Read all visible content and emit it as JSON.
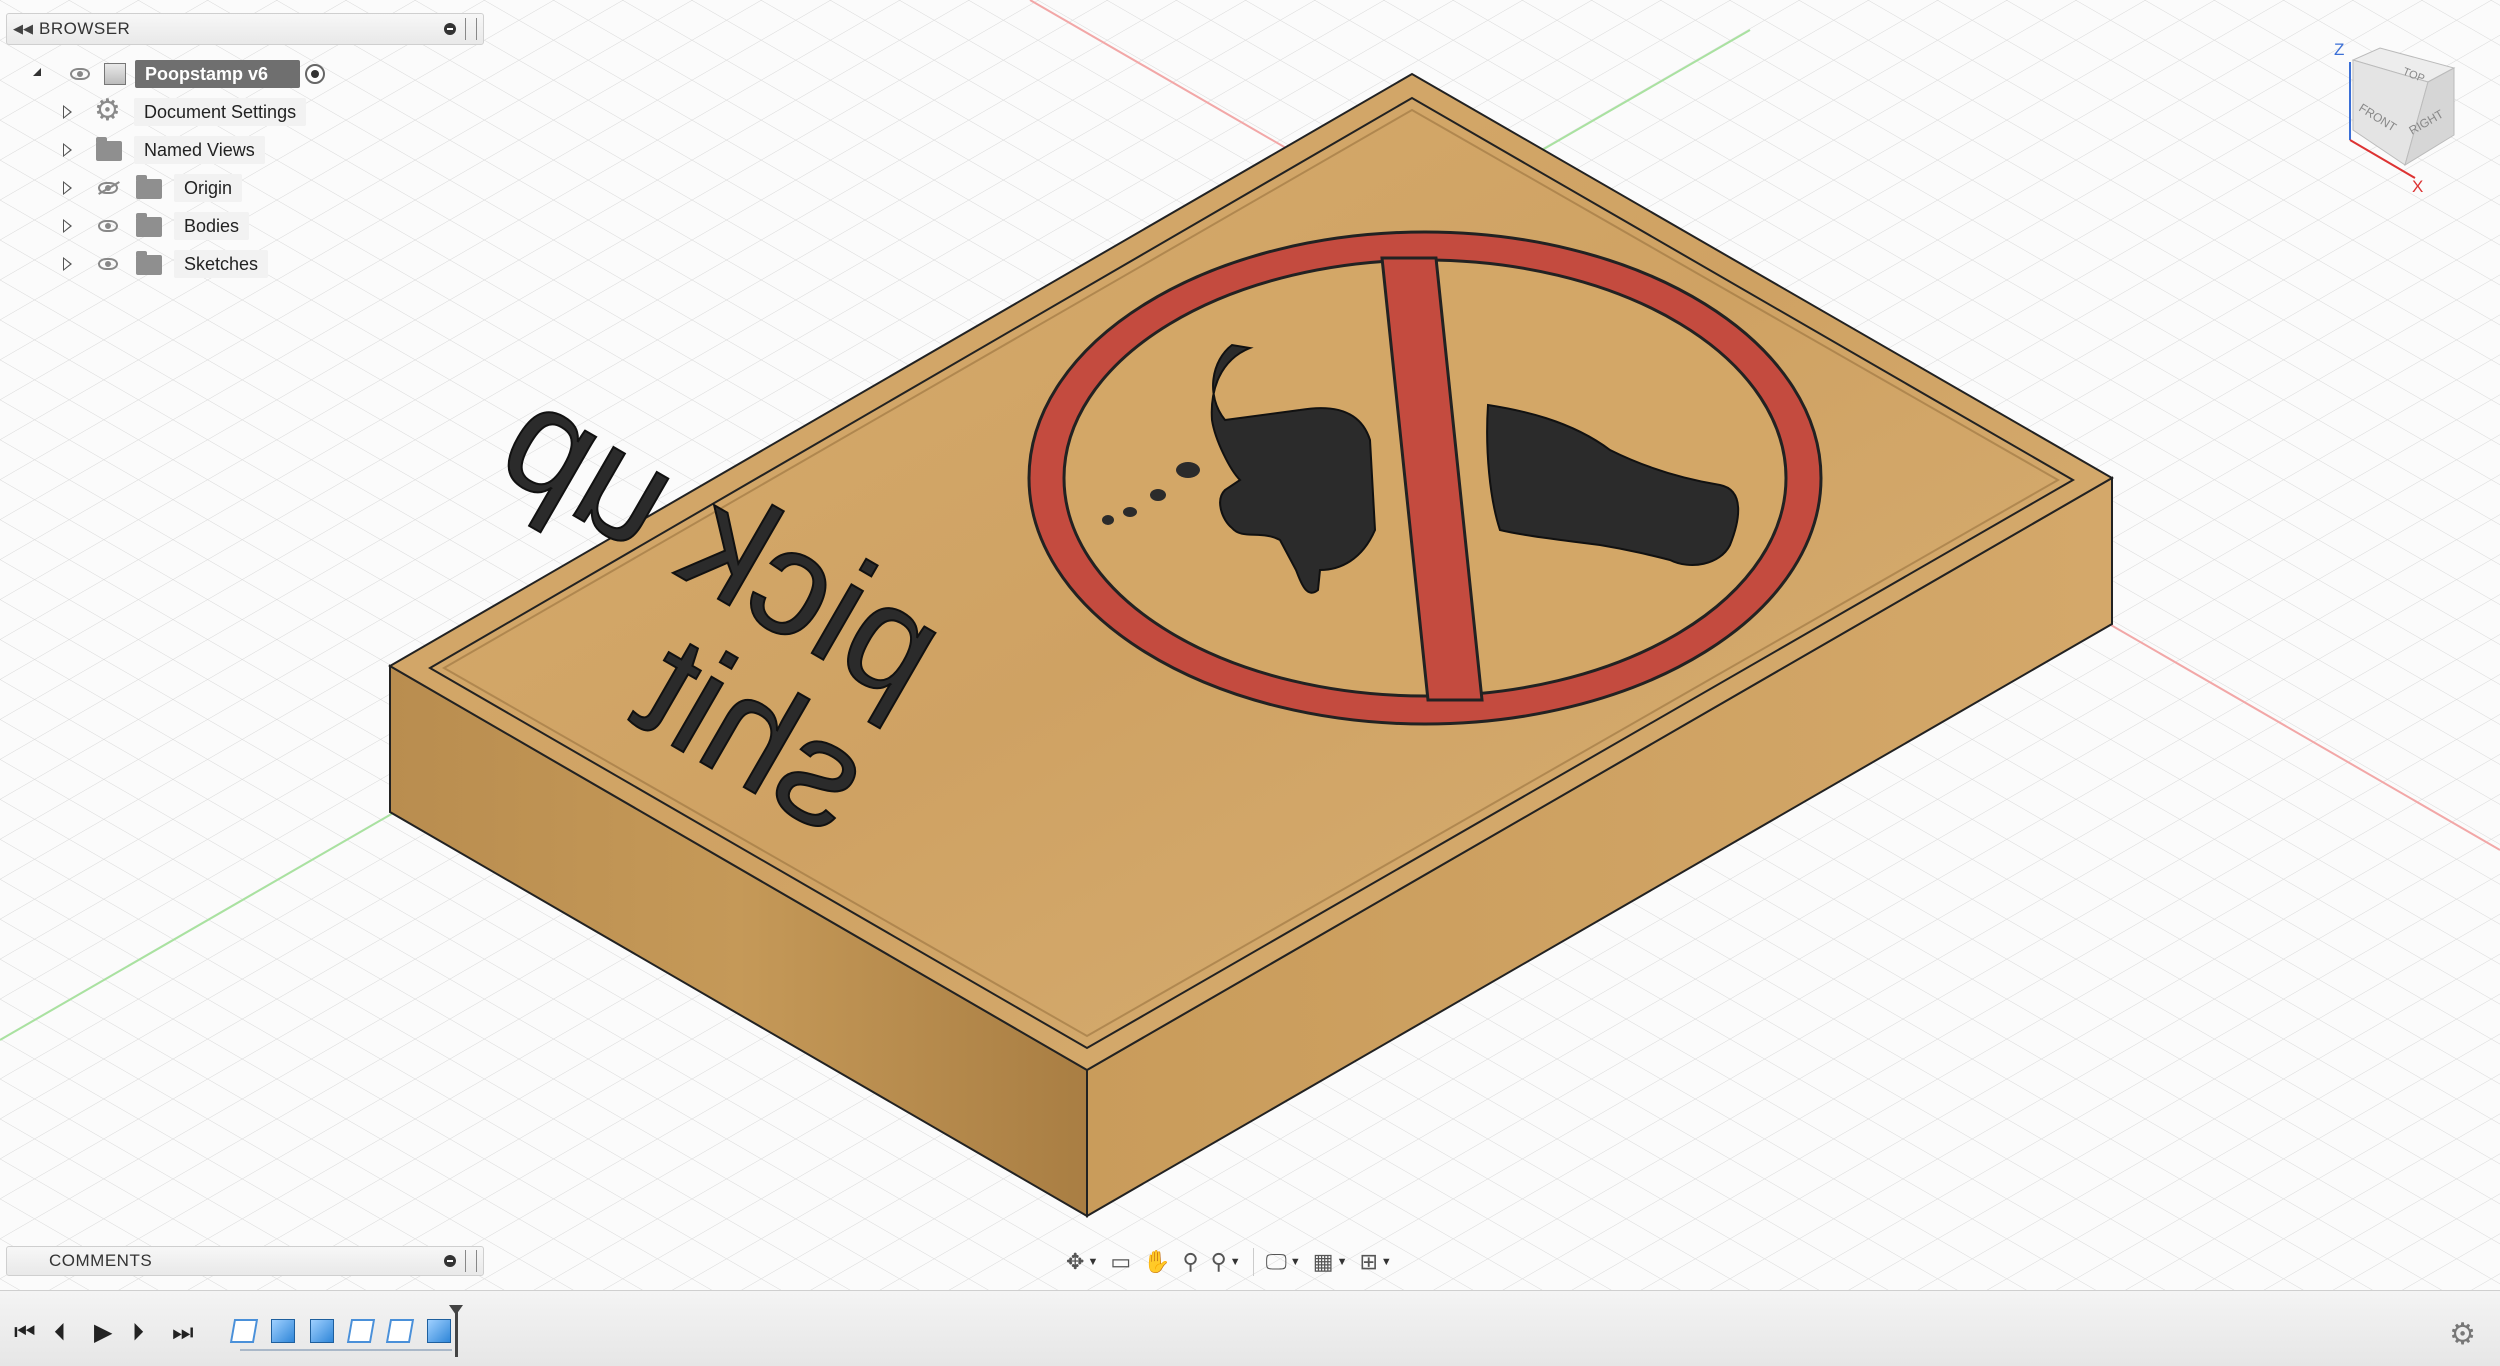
{
  "browser": {
    "title": "BROWSER",
    "root": {
      "label": "Poopstamp v6"
    },
    "items": [
      {
        "label": "Document Settings",
        "icon": "gear-icon",
        "visibility": "none"
      },
      {
        "label": "Named Views",
        "icon": "folder-icon",
        "visibility": "none"
      },
      {
        "label": "Origin",
        "icon": "folder-icon",
        "visibility": "hidden"
      },
      {
        "label": "Bodies",
        "icon": "folder-icon",
        "visibility": "visible"
      },
      {
        "label": "Sketches",
        "icon": "folder-icon",
        "visibility": "visible"
      }
    ]
  },
  "comments": {
    "title": "COMMENTS"
  },
  "viewcube": {
    "top": "TOP",
    "front": "FRONT",
    "right": "RIGHT",
    "axis_z": "Z",
    "axis_x": "X"
  },
  "model": {
    "text_line1": "pick up",
    "text_line2": "shit",
    "colors": {
      "wood": "#d4a86a",
      "wood_dark": "#b88a4c",
      "ring": "#c44b3f",
      "silhouette": "#2b2b2b"
    }
  },
  "nav_toolbar": [
    "orbit-icon",
    "look-at-icon",
    "pan-icon",
    "zoom-icon",
    "fit-icon",
    "display-settings-icon",
    "grid-settings-icon",
    "viewports-icon"
  ],
  "timeline": {
    "features": [
      "sketch",
      "extrude",
      "extrude",
      "sketch",
      "sketch",
      "extrude"
    ]
  }
}
